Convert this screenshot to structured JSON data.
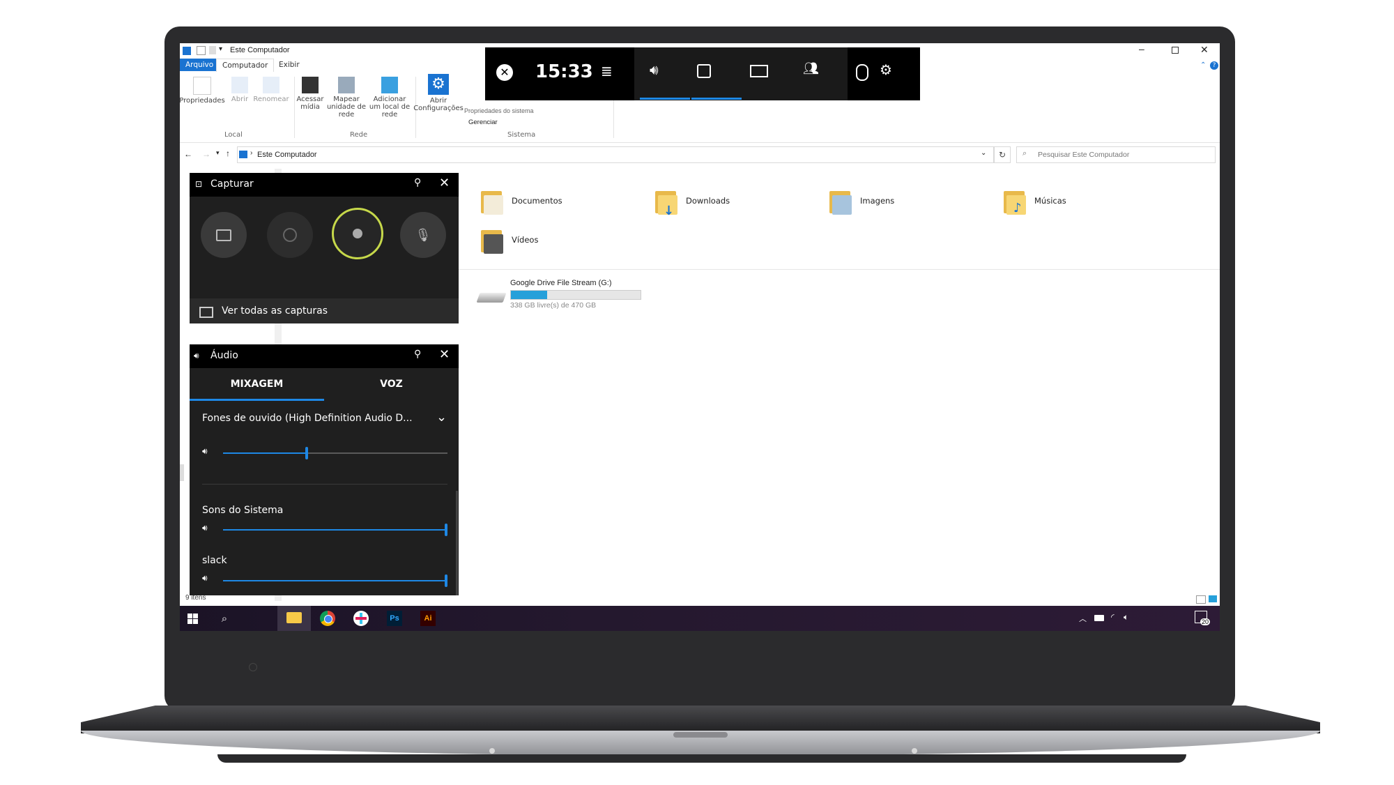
{
  "explorer": {
    "title": "Este Computador",
    "tabs": [
      "Arquivo",
      "Computador",
      "Exibir"
    ],
    "ribbon": {
      "local": {
        "label": "Local",
        "buttons": [
          "Propriedades",
          "Abrir",
          "Renomear"
        ]
      },
      "rede": {
        "label": "Rede",
        "buttons": [
          "Acessar mídia",
          "Mapear unidade de rede",
          "Adicionar um local de rede"
        ]
      },
      "sistema": {
        "label": "Sistema",
        "buttons": [
          "Abrir Configurações"
        ],
        "links": [
          "Propriedades do sistema",
          "Gerenciar"
        ]
      }
    },
    "address": "Este Computador",
    "search_placeholder": "Pesquisar Este Computador",
    "folders": [
      "Documentos",
      "Downloads",
      "Imagens",
      "Músicas",
      "Vídeos"
    ],
    "drive": {
      "name": "Google Drive File Stream (G:)",
      "free_text": "338 GB livre(s) de 470 GB",
      "used_fraction": 0.28
    },
    "status": "9 itens"
  },
  "gamebar": {
    "time": "15:33",
    "capture": {
      "title": "Capturar",
      "view_all": "Ver todas as capturas"
    },
    "audio": {
      "title": "Áudio",
      "tabs": [
        "MIXAGEM",
        "VOZ"
      ],
      "device": "Fones de ouvido (High Definition Audio D...",
      "device_level": 0.38,
      "apps": [
        {
          "name": "Sons do Sistema",
          "level": 1.0
        },
        {
          "name": "slack",
          "level": 1.0
        }
      ]
    }
  },
  "taskbar": {
    "apps": [
      "file-explorer",
      "chrome",
      "slack",
      "photoshop",
      "illustrator"
    ],
    "ps_label": "Ps",
    "ai_label": "Ai",
    "notifications": "20"
  },
  "colors": {
    "accent": "#1e88e5",
    "record_ring": "#c6d84a",
    "explorer_blue": "#1a73d1"
  }
}
